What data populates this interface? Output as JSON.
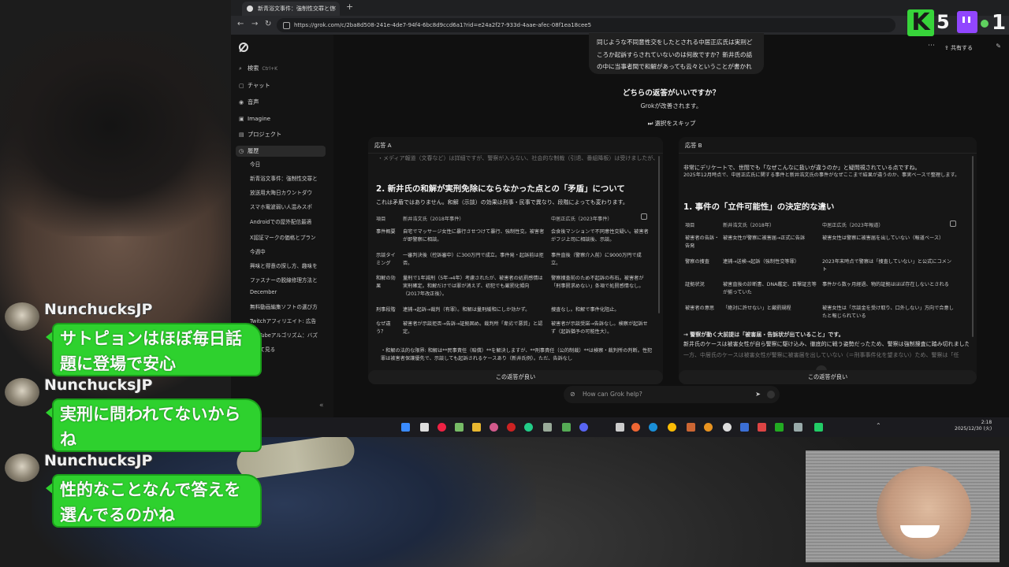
{
  "browser": {
    "tab_title": "新青浴文事件：強制性交罪と信",
    "url": "https://grok.com/c/2ba8d508-241e-4de7-94f4-6bc8d9ccd6a1?rid=e24a2f27-933d-4aae-afec-08f1ea18cee5"
  },
  "sidebar": {
    "search_label": "検索",
    "search_shortcut": "Ctrl+K",
    "items": [
      {
        "icon": "chat-icon",
        "label": "チャット"
      },
      {
        "icon": "voice-icon",
        "label": "音声"
      },
      {
        "icon": "image-icon",
        "label": "Imagine"
      },
      {
        "icon": "project-icon",
        "label": "プロジェクト"
      },
      {
        "icon": "history-icon",
        "label": "履歴"
      }
    ],
    "history": [
      "今日",
      "新青浴文事件：強制性交罪と",
      "放送用大晦日カウントダウ",
      "スマホ電波弱い人混みスポ",
      "Androidでの屋外配信最適",
      "X認証マークの価格とプラン",
      "今週中",
      "興味と得意の探し方、趣味を",
      "ファスナーの脱線修理方法と",
      "December",
      "無料動画編集ソフトの選び方",
      "Twitchアフィリエイト: 広告",
      "YouTubeアルゴリズム：バズ",
      "すべて見る"
    ]
  },
  "header": {
    "share_label": "共有する"
  },
  "conversation": {
    "user_question": "同じような不同意性交をしたとされる中居正広氏は実刑どころか起訴すらされていないのは何故ですか？新井氏の話の中に当事者間で和解があっても云々ということが書かれていましたが 矛盾していませんか？",
    "compare_title": "どちらの返答がいいですか？",
    "compare_subtitle": "Grokが改善されます。",
    "skip_label": "選択をスキップ"
  },
  "response_a": {
    "header": "応答 A",
    "top_line": "・メディア報道（文春など）は詳細ですが、警察が入らない、社会的な制裁（引退、番組降板）は受けましたが、刑事責任は別。",
    "heading": "2. 新井氏の和解が実刑免除にならなかった点との「矛盾」について",
    "intro": "これは矛盾ではありません。和解（示談）の効果は刑事・民事で異なり、段階によっても変わります。",
    "columns": [
      "項目",
      "新井浩文氏（2018年事件）",
      "中居正広氏（2023年事件）"
    ],
    "rows": [
      [
        "事件概要",
        "自宅でマッサージ女性に暴行させつけて暴行、強制性交。被害者が即警察に相談。",
        "会食後マンションで不同意性交疑い。被害者がフジ上司に相談後、示談。"
      ],
      [
        "示談タイミング",
        "一審判決後（控訴審中）に300万円で成立。事件発・起訴前は拒否。",
        "事件直後（警察介入前）に9000万円で成立。"
      ],
      [
        "和解の効果",
        "量刑で1年減刑（5年→4年）考慮されたが、被害者の処罰感情は実刑確定。和解だけでは罪が消えず、初犯でも厳罰化傾向（2017年改正後）。",
        "警察捜査前のため不起訴の布石。被害者が「刑事罰求めない」条項で処罰感情なし。"
      ],
      [
        "刑事段階",
        "逮捕→起訴→裁判（有罪）。和解は量刑緩和にしか効かず。",
        "捜査なし。和解で事件化阻止。"
      ],
      [
        "なぜ違う？",
        "被害者が示談拒否→告訴→証拠固め。裁判所「卑劣で悪質」と認定。",
        "被害者が示談受諾→告訴なし。検察が起訴せず（起訴猶予の可能性大）。"
      ]
    ],
    "bullet": "・和解の法的な限界: 和解は**民事責任（賠償）**を解決しますが、**刑事責任（公的制裁）**は検察・裁判所の判断。性犯罪は被害者保護優先で、示談しても起訴されるケースあり（新井氏例）。ただ、告訴なし",
    "better_button": "この返答が良い"
  },
  "response_b": {
    "header": "応答 B",
    "intro1": "非常にデリケートで、世間でも「なぜこんなに扱いが違うのか」と疑問視されている点ですね。",
    "intro2": "2025年12月時点で、中居正広氏に関する事件と新井浩文氏の事件がなぜここまで結果が違うのか、事実ベースで整理します。",
    "heading": "1. 事件の「立件可能性」の決定的な違い",
    "columns": [
      "項目",
      "新井浩文氏（2018年）",
      "中居正広氏（2023年報道）"
    ],
    "rows": [
      [
        "被害者の告訴・告発",
        "被害女性が警察に被害届→正式に告訴",
        "被害女性は警察に被害届を出していない（報道ベース）"
      ],
      [
        "警察の捜査",
        "逮捕→送検→起訴（強制性交等罪）",
        "2023年末時点で警察は「捜査していない」と公式にコメント"
      ],
      [
        "証拠状況",
        "被害直後の診断書、DNA鑑定、目撃証言等が揃っていた",
        "事件から数ヶ月経過、物的証拠はほぼ存在しないとされる"
      ],
      [
        "被害者の意思",
        "「絶対に許せない」と厳罰規程",
        "被害女性は「示談金を受け取り、口外しない」方向で合意したと報じられている"
      ]
    ],
    "point": "→ 警察が動く大前提は「被害届・告訴状が出ていること」です。",
    "point2": "新井氏のケースは被害女性が自ら警察に駆け込み、徹底的に戦う姿勢だったため、警察は強制捜査に踏み切れました。",
    "point3": "一方、中居氏のケースは被害女性が警察に被害届を出していない（＝刑事事件化を望まない）ため、警察は「任",
    "better_button": "この返答が良い"
  },
  "input": {
    "placeholder": "How can Grok help?"
  },
  "taskbar": {
    "time": "2:18",
    "date": "2025/12/30 (火)"
  },
  "overlay": {
    "kick_count": "5",
    "twitch_count": "1"
  },
  "chat": [
    {
      "user": "NunchucksJP",
      "message_lines": [
        "サトピョンはほぼ毎日話",
        "題に登場で安心"
      ]
    },
    {
      "user": "NunchucksJP",
      "message_lines": [
        "実刑に問われてないから",
        "ね"
      ]
    },
    {
      "user": "NunchucksJP",
      "message_lines": [
        "性的なことなんで答えを",
        "選んでるのかね"
      ]
    }
  ],
  "colors": {
    "kick_green": "#37d43a",
    "twitch_purple": "#9146ff",
    "chat_green": "#2ed12e"
  }
}
